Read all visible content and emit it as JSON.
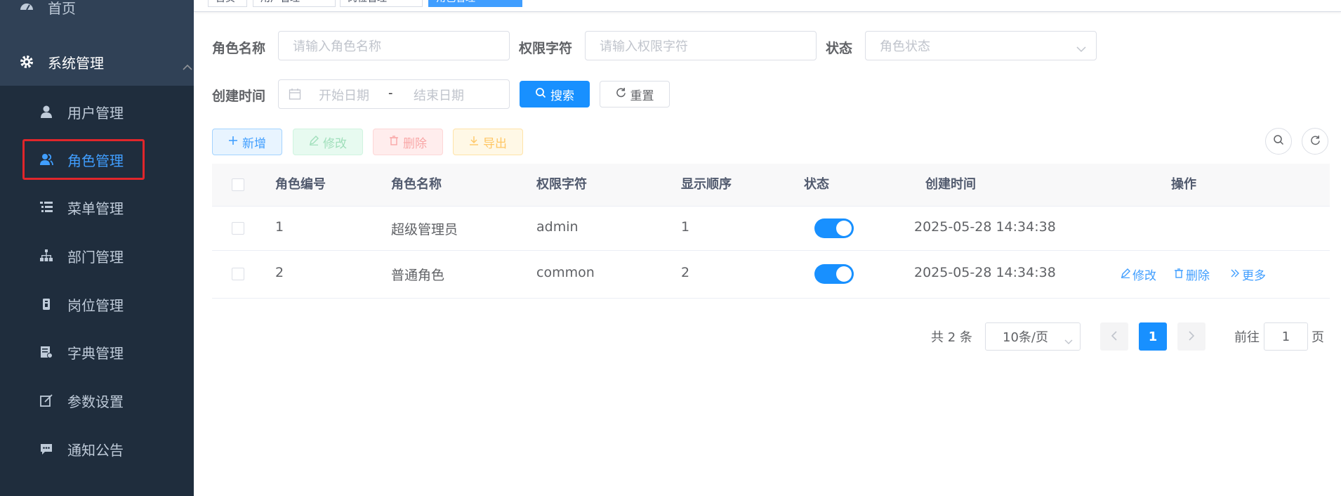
{
  "sidebar": {
    "home": "首页",
    "system": "系统管理",
    "items": [
      {
        "label": "用户管理",
        "icon": "user-icon"
      },
      {
        "label": "角色管理",
        "icon": "peoples-icon"
      },
      {
        "label": "菜单管理",
        "icon": "tree-table-icon"
      },
      {
        "label": "部门管理",
        "icon": "tree-icon"
      },
      {
        "label": "岗位管理",
        "icon": "post-icon"
      },
      {
        "label": "字典管理",
        "icon": "dict-icon"
      },
      {
        "label": "参数设置",
        "icon": "edit-icon"
      },
      {
        "label": "通知公告",
        "icon": "message-icon"
      }
    ]
  },
  "tags": [
    "首页",
    "用户管理",
    "岗位管理",
    "角色管理"
  ],
  "search": {
    "role_name_label": "角色名称",
    "role_name_placeholder": "请输入角色名称",
    "role_key_label": "权限字符",
    "role_key_placeholder": "请输入权限字符",
    "status_label": "状态",
    "status_placeholder": "角色状态",
    "create_time_label": "创建时间",
    "start_placeholder": "开始日期",
    "range_separator": "-",
    "end_placeholder": "结束日期",
    "search_button": "搜索",
    "reset_button": "重置"
  },
  "toolbar": {
    "add": "新增",
    "edit": "修改",
    "delete": "删除",
    "export": "导出"
  },
  "table": {
    "headers": [
      "角色编号",
      "角色名称",
      "权限字符",
      "显示顺序",
      "状态",
      "创建时间",
      "操作"
    ],
    "rows": [
      {
        "id": "1",
        "name": "超级管理员",
        "key": "admin",
        "sort": "1",
        "status": true,
        "created": "2025-05-28 14:34:38"
      },
      {
        "id": "2",
        "name": "普通角色",
        "key": "common",
        "sort": "2",
        "status": true,
        "created": "2025-05-28 14:34:38"
      }
    ],
    "actions": {
      "edit": "修改",
      "delete": "删除",
      "more": "更多"
    }
  },
  "pagination": {
    "total": "共 2 条",
    "page_size": "10条/页",
    "current_page": "1",
    "goto_label": "前往",
    "goto_value": "1",
    "page_suffix": "页"
  },
  "colors": {
    "sidebar_bg": "#304156",
    "submenu_bg": "#1f2d3d",
    "primary": "#1890ff",
    "highlight": "#e0262b"
  }
}
